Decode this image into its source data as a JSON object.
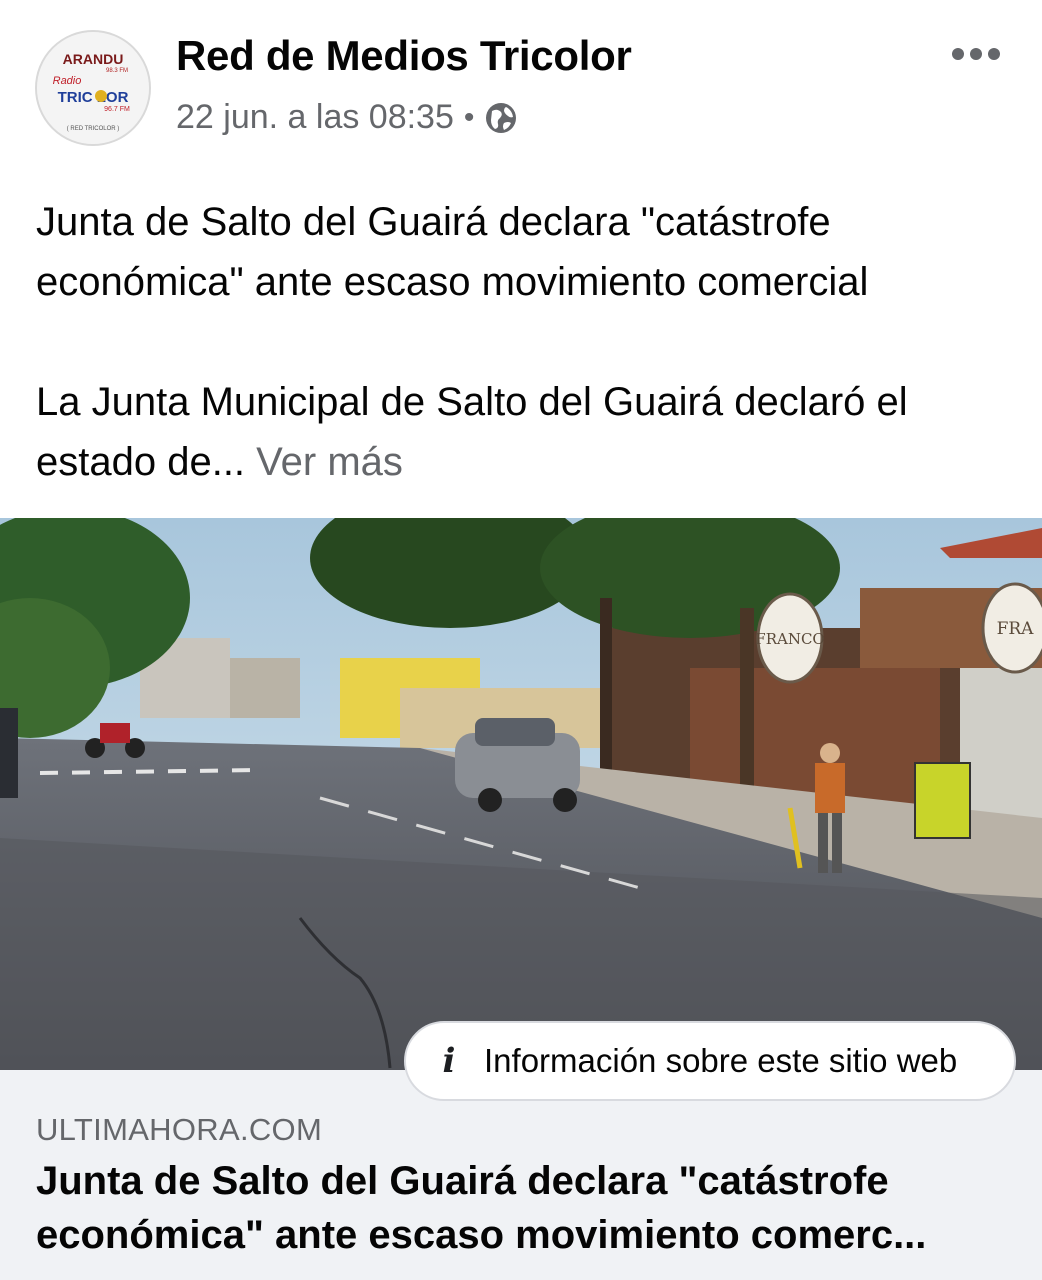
{
  "post": {
    "page_name": "Red de Medios Tricolor",
    "timestamp": "22 jun. a las 08:35",
    "separator": "•",
    "audience_icon": "globe-icon",
    "more_icon": "more-options-icon",
    "avatar": {
      "line1": "ARANDU",
      "line1_sub": "98.3 FM",
      "line2": "Radio",
      "line3": "TRIC  LOR",
      "line3_sub": "96.7 FM",
      "line4": "( RED TRICOLOR )"
    },
    "headline": "Junta de Salto del Guairá declara \"catástrofe económica\" ante escaso movimiento comercial",
    "body_preview": "La Junta Municipal de Salto del Guairá declaró el estado de...",
    "see_more": "Ver más"
  },
  "photo": {
    "sign_left": "FRANCO",
    "sign_right": "FRA"
  },
  "site_info_button": {
    "icon": "info-icon",
    "label": "Información sobre este sitio web"
  },
  "link_preview": {
    "domain": "ULTIMAHORA.COM",
    "title_line1": "Junta de Salto del Guairá declara \"catástrofe",
    "title_line2": "económica\" ante escaso movimiento comerc..."
  }
}
